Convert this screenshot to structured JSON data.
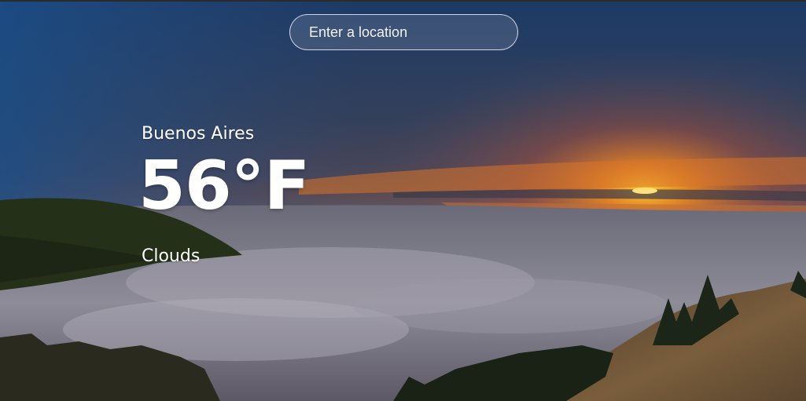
{
  "search": {
    "placeholder": "Enter a location"
  },
  "weather": {
    "city": "Buenos Aires",
    "temperature": "56°F",
    "condition": "Clouds"
  }
}
